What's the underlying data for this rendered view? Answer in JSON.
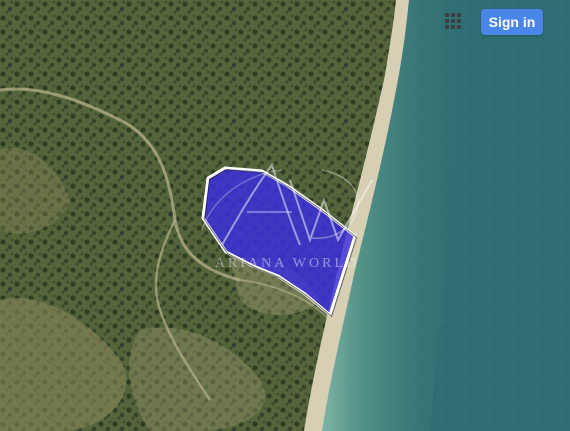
{
  "colors": {
    "land": "#4d5c36",
    "sea": "#2f6f73",
    "sea_shallow": "#5c9a8c",
    "beach": "#d6cfb4",
    "parcel_fill": "#3a2de0",
    "parcel_stroke": "#ffffff",
    "button_blue": "#4a86e8"
  },
  "toolbar": {
    "apps_icon": "apps-grid-icon",
    "sign_in_label": "Sign in"
  },
  "map": {
    "type": "satellite",
    "highlighted_parcel": true
  },
  "watermark": {
    "brand_text": "ARIANA WORLD"
  }
}
